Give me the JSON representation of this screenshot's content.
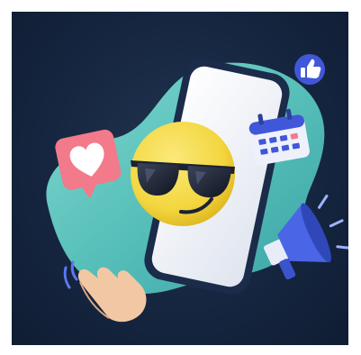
{
  "scene": {
    "subject": "smartphone-with-sunglasses-emoji",
    "icons": [
      "heart-icon",
      "thumbs-up-icon",
      "calendar-icon",
      "megaphone-icon",
      "waving-hand-icon"
    ],
    "colors": {
      "background": "#162640",
      "blob": "#5fc6c0",
      "blob_light": "#8fe0d5",
      "phone_body": "#1b2b4a",
      "phone_screen": "#eef0f6",
      "emoji_face": "#f6d84a",
      "sunglasses": "#1b2233",
      "heart_bubble": "#f27a8a",
      "thumbs_badge": "#3f57d8",
      "calendar": "#3f57d8",
      "megaphone": "#4a66e6",
      "hand": "#f2c7a3"
    }
  }
}
